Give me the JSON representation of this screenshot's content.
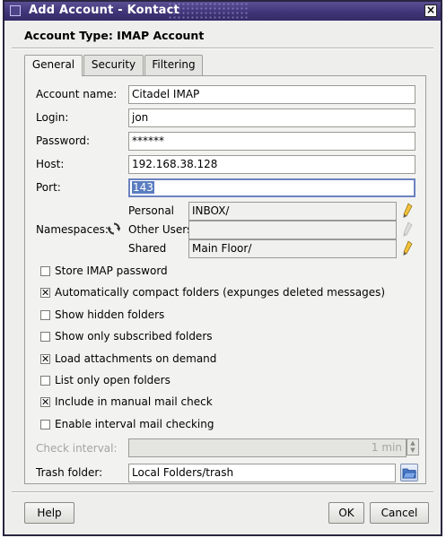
{
  "window": {
    "title": "Add Account - Kontact",
    "close_symbol": "×"
  },
  "header": {
    "title": "Account Type: IMAP Account"
  },
  "tabs": [
    {
      "label": "General",
      "active": true
    },
    {
      "label": "Security",
      "active": false
    },
    {
      "label": "Filtering",
      "active": false
    }
  ],
  "form": {
    "account_name": {
      "label": "Account name:",
      "value": "Citadel IMAP"
    },
    "login": {
      "label": "Login:",
      "value": "jon"
    },
    "password": {
      "label": "Password:",
      "value": "******"
    },
    "host": {
      "label": "Host:",
      "value": "192.168.38.128"
    },
    "port": {
      "label": "Port:",
      "value": "143"
    },
    "namespaces": {
      "label": "Namespaces:",
      "refresh_icon": "refresh-icon",
      "rows": [
        {
          "label": "Personal",
          "value": "INBOX/",
          "editable": true
        },
        {
          "label": "Other Users",
          "value": "",
          "editable": false
        },
        {
          "label": "Shared",
          "value": "Main Floor/",
          "editable": true
        }
      ]
    },
    "checkboxes": [
      {
        "label": "Store IMAP password",
        "checked": false
      },
      {
        "label": "Automatically compact folders (expunges deleted messages)",
        "checked": true
      },
      {
        "label": "Show hidden folders",
        "checked": false
      },
      {
        "label": "Show only subscribed folders",
        "checked": false
      },
      {
        "label": "Load attachments on demand",
        "checked": true
      },
      {
        "label": "List only open folders",
        "checked": false
      },
      {
        "label": "Include in manual mail check",
        "checked": true
      },
      {
        "label": "Enable interval mail checking",
        "checked": false
      }
    ],
    "check_interval": {
      "label": "Check interval:",
      "value": "1 min",
      "enabled": false
    },
    "trash_folder": {
      "label": "Trash folder:",
      "value": "Local Folders/trash"
    }
  },
  "buttons": {
    "help": "Help",
    "ok": "OK",
    "cancel": "Cancel"
  },
  "colors": {
    "titlebar": "#3f3578",
    "selection": "#5a7dc0"
  }
}
